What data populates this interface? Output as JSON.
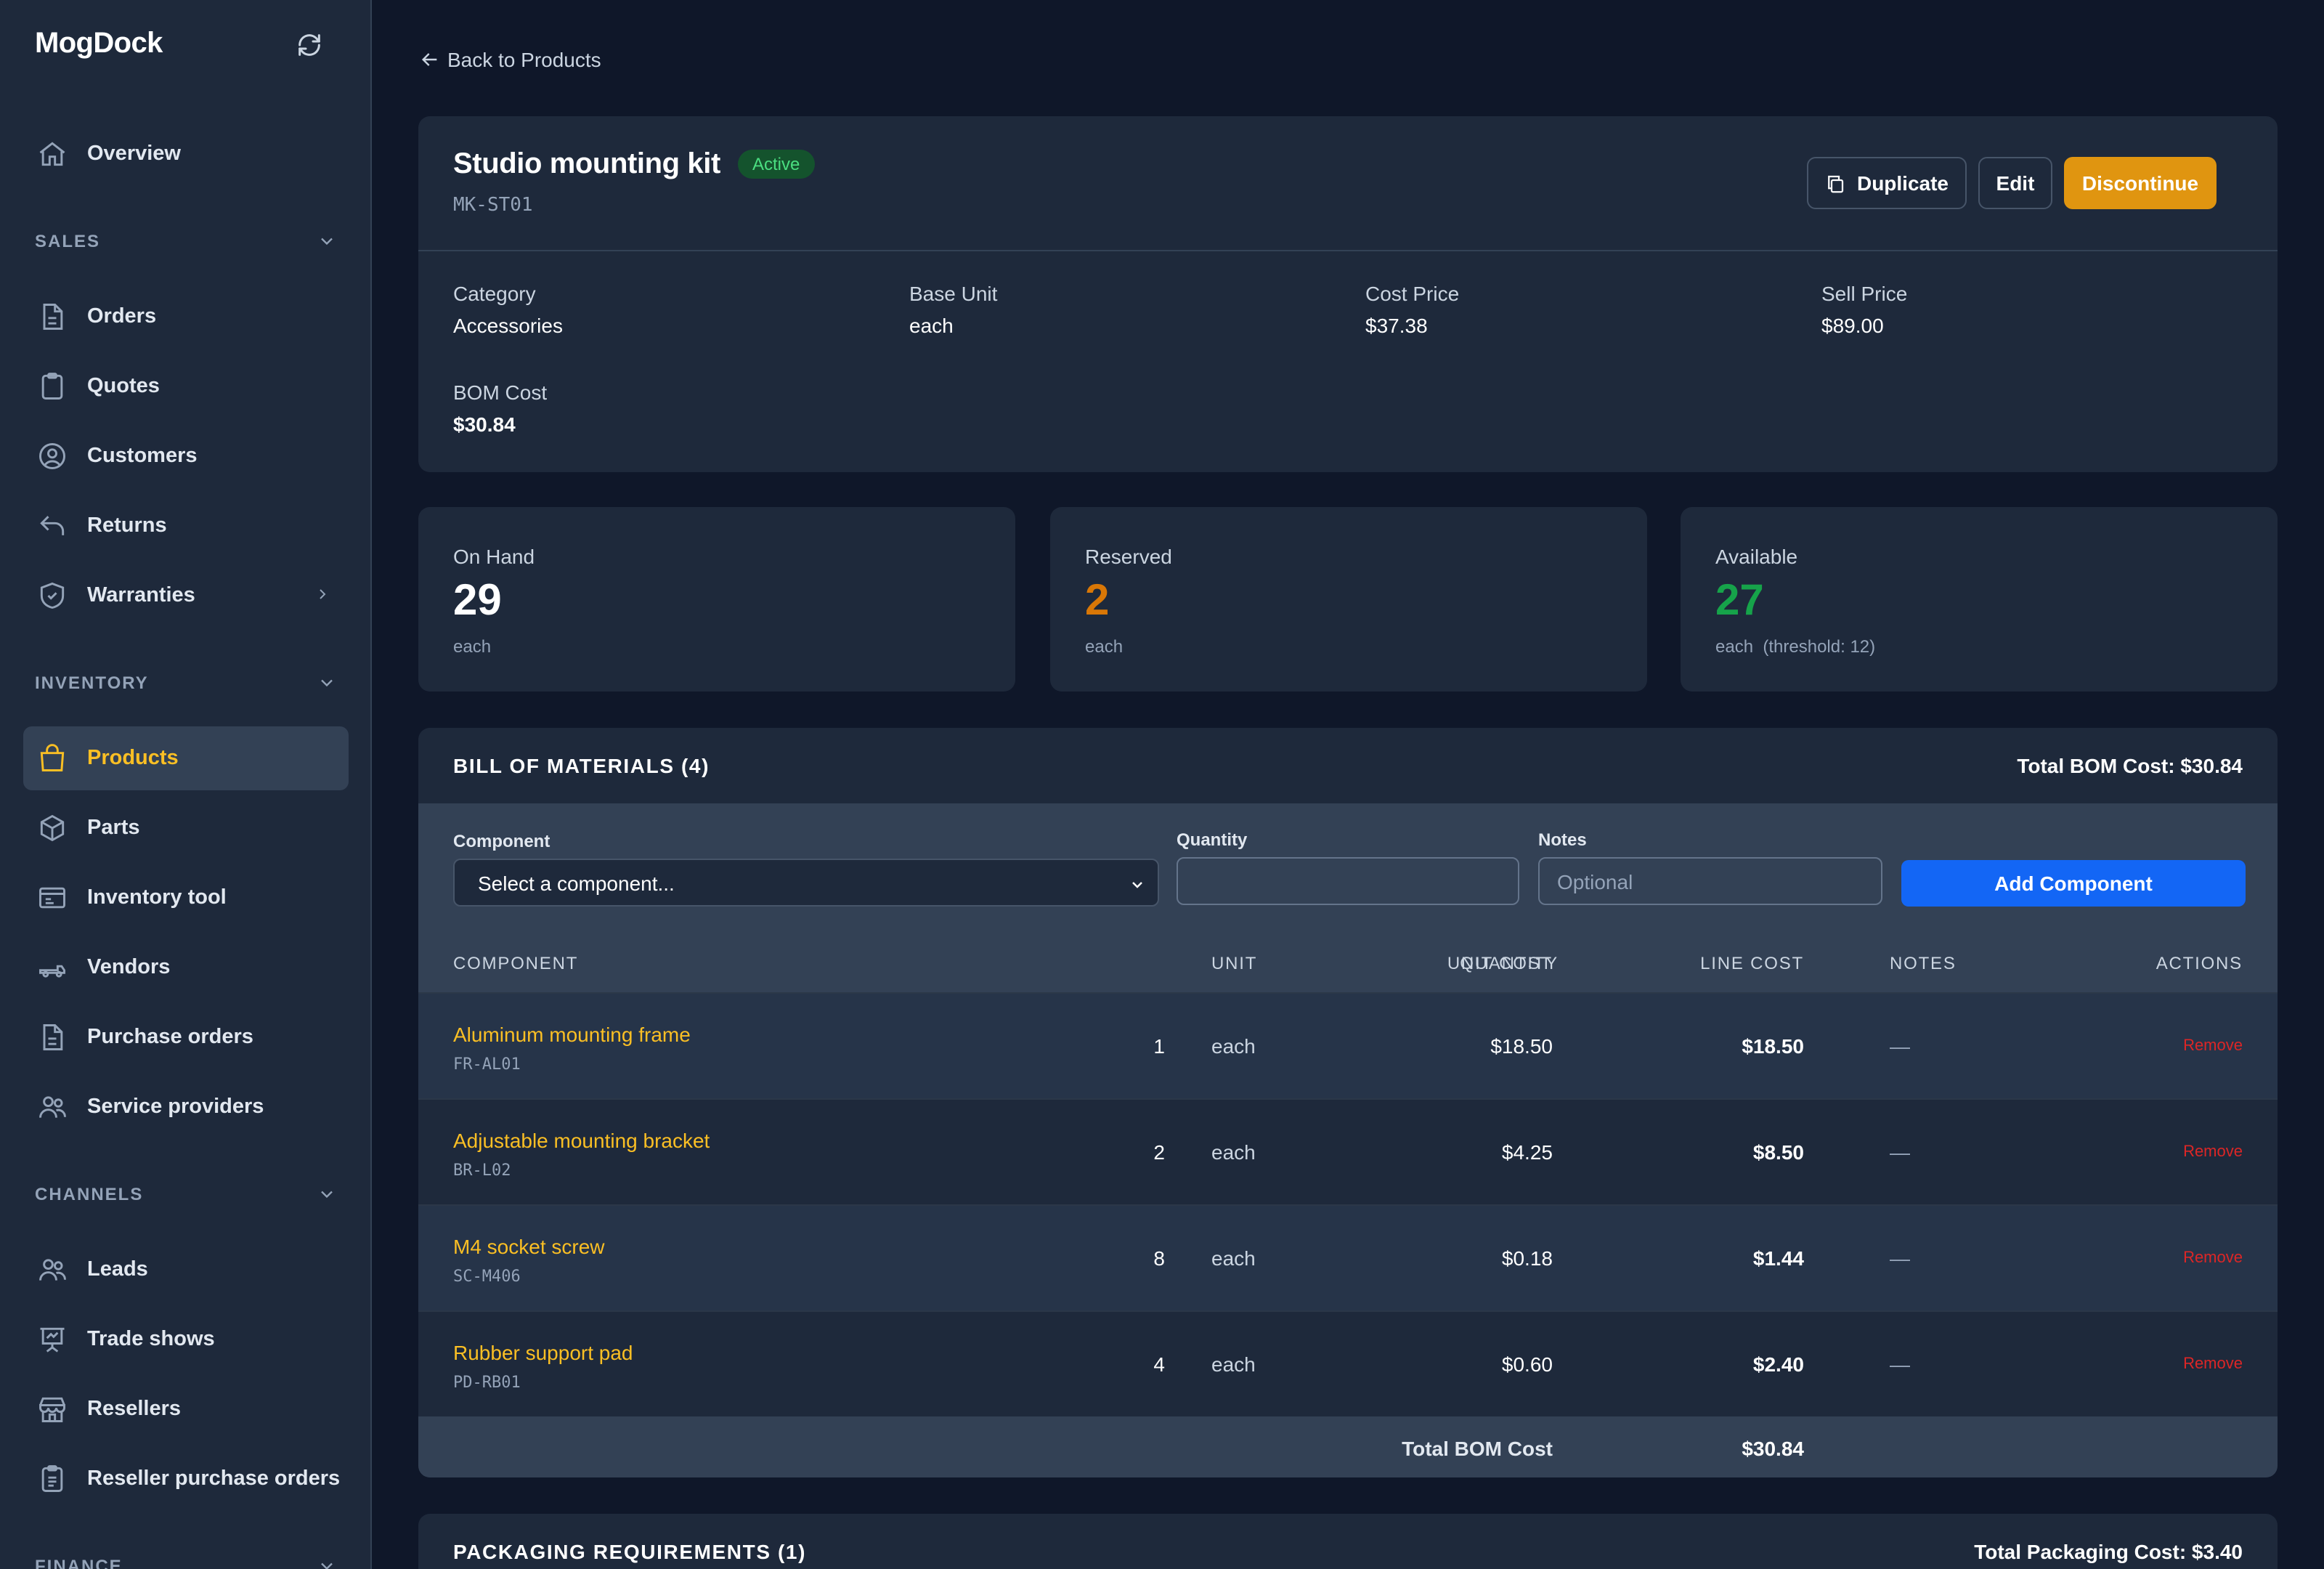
{
  "app": {
    "name": "MogDock"
  },
  "sidebar": {
    "overview": "Overview",
    "sections": {
      "sales": "SALES",
      "inventory": "INVENTORY",
      "channels": "CHANNELS",
      "finance": "FINANCE"
    },
    "sales_items": [
      "Orders",
      "Quotes",
      "Customers",
      "Returns",
      "Warranties"
    ],
    "inventory_items": [
      "Products",
      "Parts",
      "Inventory tool",
      "Vendors",
      "Purchase orders",
      "Service providers"
    ],
    "channel_items": [
      "Leads",
      "Trade shows",
      "Resellers",
      "Reseller purchase orders"
    ]
  },
  "back_link": "Back to Products",
  "product": {
    "name": "Studio mounting kit",
    "status": "Active",
    "sku": "MK-ST01",
    "buttons": {
      "duplicate": "Duplicate",
      "edit": "Edit",
      "discontinue": "Discontinue"
    },
    "fields": {
      "category_label": "Category",
      "category": "Accessories",
      "base_unit_label": "Base Unit",
      "base_unit": "each",
      "cost_price_label": "Cost Price",
      "cost_price": "$37.38",
      "sell_price_label": "Sell Price",
      "sell_price": "$89.00",
      "bom_cost_label": "BOM Cost",
      "bom_cost": "$30.84"
    }
  },
  "stats": {
    "on_hand": {
      "label": "On Hand",
      "value": "29",
      "unit": "each"
    },
    "reserved": {
      "label": "Reserved",
      "value": "2",
      "unit": "each"
    },
    "available": {
      "label": "Available",
      "value": "27",
      "unit": "each  (threshold: 12)"
    }
  },
  "bom": {
    "title": "BILL OF MATERIALS (4)",
    "total_header": "Total BOM Cost: $30.84",
    "form": {
      "component_label": "Component",
      "component_value": "Select a component...",
      "quantity_label": "Quantity",
      "quantity_value": "",
      "notes_label": "Notes",
      "notes_placeholder": "Optional",
      "add_button": "Add Component"
    },
    "columns": [
      "COMPONENT",
      "QUANTITY",
      "UNIT",
      "UNIT COST",
      "LINE COST",
      "NOTES",
      "ACTIONS"
    ],
    "rows": [
      {
        "name": "Aluminum mounting frame",
        "sku": "FR-AL01",
        "qty": "1",
        "unit": "each",
        "unit_cost": "$18.50",
        "line_cost": "$18.50",
        "notes": "—",
        "action": "Remove"
      },
      {
        "name": "Adjustable mounting bracket",
        "sku": "BR-L02",
        "qty": "2",
        "unit": "each",
        "unit_cost": "$4.25",
        "line_cost": "$8.50",
        "notes": "—",
        "action": "Remove"
      },
      {
        "name": "M4 socket screw",
        "sku": "SC-M406",
        "qty": "8",
        "unit": "each",
        "unit_cost": "$0.18",
        "line_cost": "$1.44",
        "notes": "—",
        "action": "Remove"
      },
      {
        "name": "Rubber support pad",
        "sku": "PD-RB01",
        "qty": "4",
        "unit": "each",
        "unit_cost": "$0.60",
        "line_cost": "$2.40",
        "notes": "—",
        "action": "Remove"
      }
    ],
    "footer_label": "Total BOM Cost",
    "footer_value": "$30.84"
  },
  "packaging": {
    "title": "PACKAGING REQUIREMENTS (1)",
    "total": "Total Packaging Cost: $3.40"
  }
}
